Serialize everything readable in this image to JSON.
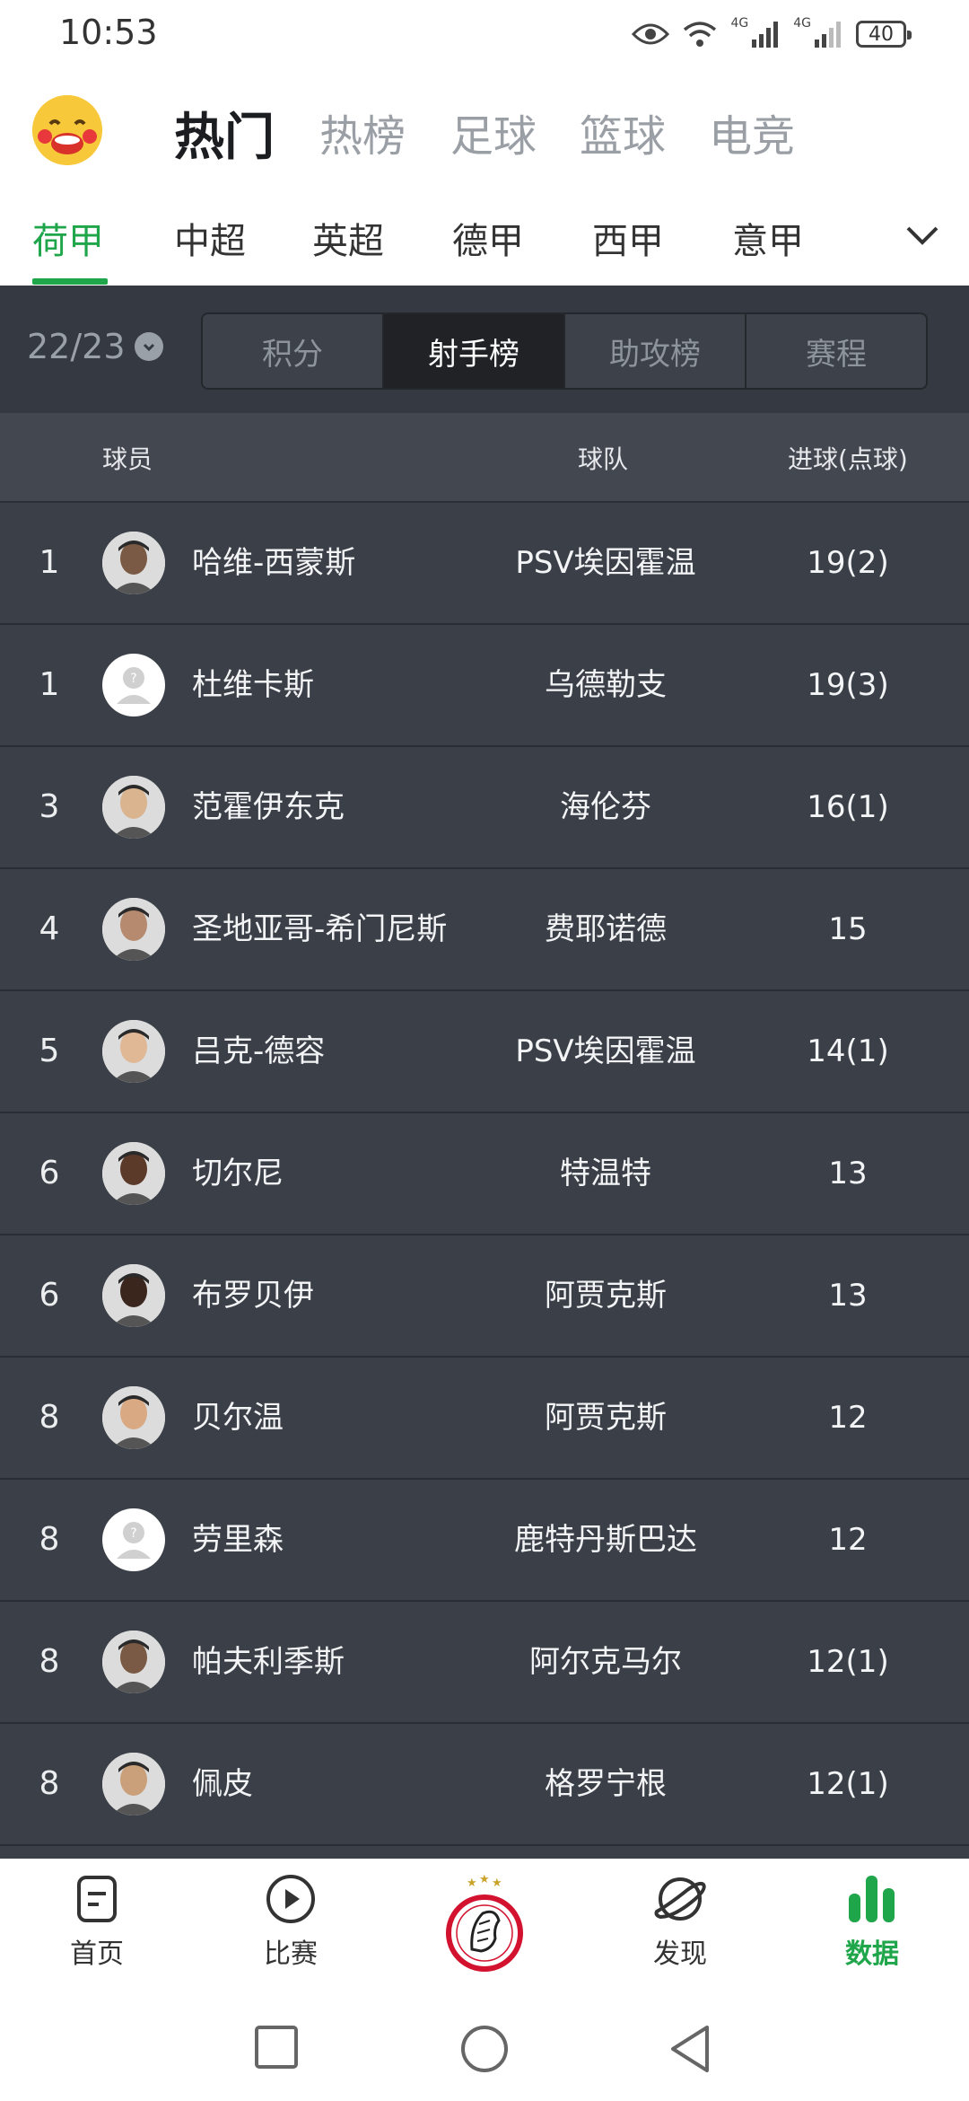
{
  "status": {
    "time": "10:53",
    "battery": "40",
    "net1": "4G",
    "net2": "4G"
  },
  "top_tabs": [
    {
      "label": "热门",
      "active": true
    },
    {
      "label": "热榜"
    },
    {
      "label": "足球"
    },
    {
      "label": "篮球"
    },
    {
      "label": "电竞"
    }
  ],
  "league_tabs": [
    {
      "label": "荷甲",
      "active": true
    },
    {
      "label": "中超"
    },
    {
      "label": "英超"
    },
    {
      "label": "德甲"
    },
    {
      "label": "西甲"
    },
    {
      "label": "意甲"
    }
  ],
  "season": "22/23",
  "segments": [
    {
      "label": "积分"
    },
    {
      "label": "射手榜",
      "active": true
    },
    {
      "label": "助攻榜"
    },
    {
      "label": "赛程"
    }
  ],
  "columns": {
    "player": "球员",
    "team": "球队",
    "goals": "进球(点球)"
  },
  "rows": [
    {
      "rank": "1",
      "name": "哈维-西蒙斯",
      "team": "PSV埃因霍温",
      "goals": "19(2)",
      "avatar": "photo"
    },
    {
      "rank": "1",
      "name": "杜维卡斯",
      "team": "乌德勒支",
      "goals": "19(3)",
      "avatar": "placeholder"
    },
    {
      "rank": "3",
      "name": "范霍伊东克",
      "team": "海伦芬",
      "goals": "16(1)",
      "avatar": "photo"
    },
    {
      "rank": "4",
      "name": "圣地亚哥-希门尼斯",
      "team": "费耶诺德",
      "goals": "15",
      "avatar": "photo"
    },
    {
      "rank": "5",
      "name": "吕克-德容",
      "team": "PSV埃因霍温",
      "goals": "14(1)",
      "avatar": "photo"
    },
    {
      "rank": "6",
      "name": "切尔尼",
      "team": "特温特",
      "goals": "13",
      "avatar": "photo"
    },
    {
      "rank": "6",
      "name": "布罗贝伊",
      "team": "阿贾克斯",
      "goals": "13",
      "avatar": "photo"
    },
    {
      "rank": "8",
      "name": "贝尔温",
      "team": "阿贾克斯",
      "goals": "12",
      "avatar": "photo"
    },
    {
      "rank": "8",
      "name": "劳里森",
      "team": "鹿特丹斯巴达",
      "goals": "12",
      "avatar": "placeholder"
    },
    {
      "rank": "8",
      "name": "帕夫利季斯",
      "team": "阿尔克马尔",
      "goals": "12(1)",
      "avatar": "photo"
    },
    {
      "rank": "8",
      "name": "佩皮",
      "team": "格罗宁根",
      "goals": "12(1)",
      "avatar": "photo"
    }
  ],
  "bottom_nav": [
    {
      "label": "首页",
      "icon": "home-doc-icon"
    },
    {
      "label": "比赛",
      "icon": "play-icon"
    },
    {
      "label": "",
      "icon": "ajax-logo"
    },
    {
      "label": "发现",
      "icon": "planet-icon"
    },
    {
      "label": "数据",
      "icon": "bar-chart-icon",
      "active": true
    }
  ],
  "colors": {
    "accent": "#1fa64a",
    "table_bg": "#3b3f47",
    "active_segment": "#202226"
  }
}
